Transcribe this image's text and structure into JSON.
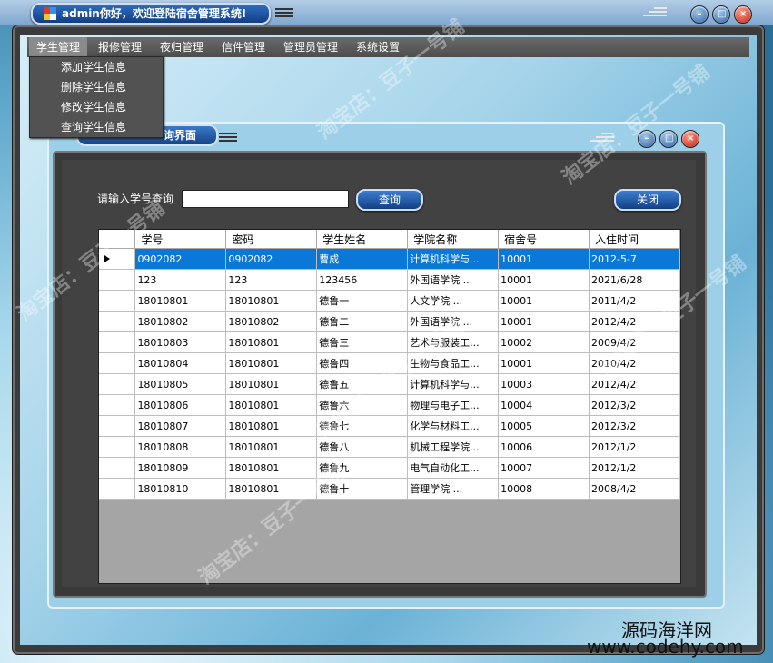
{
  "window": {
    "title": "admin你好，欢迎登陆宿舍管理系统!"
  },
  "menu": {
    "items": [
      "学生管理",
      "报修管理",
      "夜归管理",
      "信件管理",
      "管理员管理",
      "系统设置"
    ],
    "dropdown": [
      "添加学生信息",
      "删除学生信息",
      "修改学生信息",
      "查询学生信息"
    ]
  },
  "child": {
    "title": "询界面"
  },
  "query": {
    "label": "请输入学号查询",
    "value": "",
    "search_label": "查询",
    "close_label": "关闭"
  },
  "grid": {
    "columns": [
      "学号",
      "密码",
      "学生姓名",
      "学院名称",
      "宿舍号",
      "入住时间"
    ],
    "rows": [
      [
        "0902082",
        "0902082",
        "曹成",
        "计算机科学与...",
        "10001",
        "2012-5-7"
      ],
      [
        "123",
        "123",
        "123456",
        "外国语学院    ...",
        "10001",
        "2021/6/28"
      ],
      [
        "18010801",
        "18010801",
        "德鲁一",
        "人文学院      ...",
        "10001",
        "2011/4/2"
      ],
      [
        "18010802",
        "18010802",
        "德鲁二",
        "外国语学院    ...",
        "10001",
        "2012/4/2"
      ],
      [
        "18010803",
        "18010801",
        "德鲁三",
        "艺术与服装工...",
        "10002",
        "2009/4/2"
      ],
      [
        "18010804",
        "18010801",
        "德鲁四",
        "生物与食品工...",
        "10001",
        "2010/4/2"
      ],
      [
        "18010805",
        "18010801",
        "德鲁五",
        "计算机科学与...",
        "10003",
        "2012/4/2"
      ],
      [
        "18010806",
        "18010801",
        "德鲁六",
        "物理与电子工...",
        "10004",
        "2012/3/2"
      ],
      [
        "18010807",
        "18010801",
        "德鲁七",
        "化学与材料工...",
        "10005",
        "2012/3/2"
      ],
      [
        "18010808",
        "18010801",
        "德鲁八",
        "机械工程学院...",
        "10006",
        "2012/1/2"
      ],
      [
        "18010809",
        "18010801",
        "德鲁九",
        "电气自动化工...",
        "10007",
        "2012/1/2"
      ],
      [
        "18010810",
        "18010801",
        "德鲁十",
        "管理学院      ...",
        "10008",
        "2008/4/2"
      ]
    ],
    "selected_row": 0
  },
  "watermark": {
    "text": "淘宝店：豆子一号铺",
    "brand_cn": "源码海洋网",
    "brand_url": "www.codehy.com"
  },
  "colors": {
    "selection": "#0a78d8",
    "title_pill": "#1a4f9a",
    "close_button": "#c01a10"
  },
  "icons": {
    "app": "app-logo-icon",
    "menu": "hamburger-icon",
    "minimize": "minimize-icon",
    "restore": "restore-icon",
    "close": "close-icon"
  }
}
